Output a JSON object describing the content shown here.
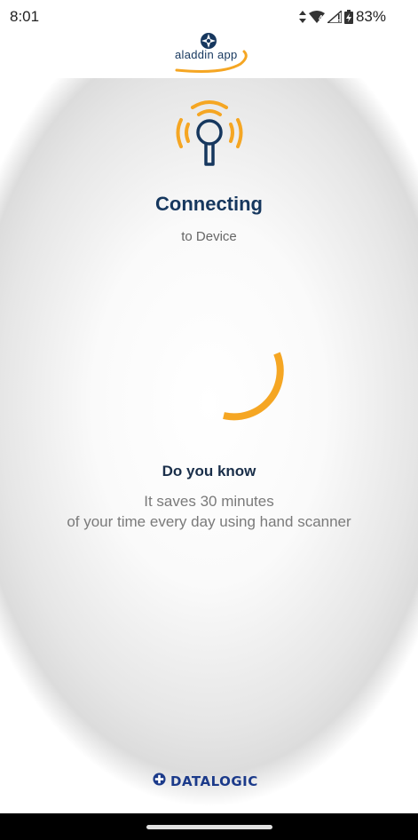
{
  "status_bar": {
    "time": "8:01",
    "network_badge": "4",
    "battery_percent": "83%",
    "icons": [
      "data-arrows-icon",
      "wifi-icon",
      "cell-signal-icon",
      "battery-charging-icon"
    ]
  },
  "logo": {
    "text": "aladdin app",
    "icon": "compass-cross-icon"
  },
  "status_icon": "scanner-signal-icon",
  "connection": {
    "title": "Connecting",
    "subtitle": "to Device"
  },
  "spinner": {
    "icon": "loading-spinner-icon"
  },
  "tip": {
    "heading": "Do you know",
    "line1": "It saves 30 minutes",
    "line2": "of your time every day using hand scanner"
  },
  "footer": {
    "brand": "DATALOGIC",
    "icon": "datalogic-logo-icon"
  },
  "colors": {
    "accent_orange": "#f5a623",
    "navy": "#16375e",
    "brand_blue": "#1b3a8a"
  }
}
